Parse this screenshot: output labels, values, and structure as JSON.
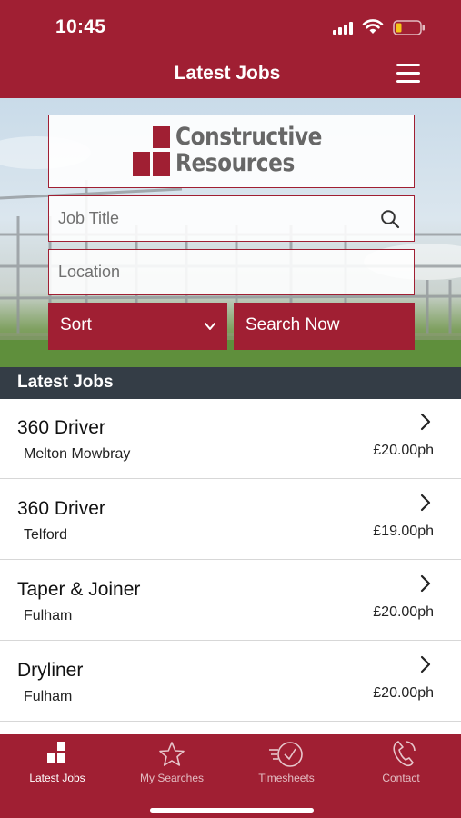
{
  "status_bar": {
    "time": "10:45"
  },
  "header": {
    "title": "Latest Jobs",
    "menu_icon": "hamburger-menu-icon"
  },
  "brand": {
    "line1": "Constructive",
    "line2": "Resources",
    "color": "#a01f33"
  },
  "search": {
    "job_title_placeholder": "Job Title",
    "location_placeholder": "Location",
    "sort_label": "Sort",
    "search_button": "Search Now"
  },
  "list": {
    "header": "Latest Jobs",
    "jobs": [
      {
        "title": "360 Driver",
        "location": "Melton Mowbray",
        "rate": "£20.00ph"
      },
      {
        "title": "360 Driver",
        "location": "Telford",
        "rate": "£19.00ph"
      },
      {
        "title": "Taper & Joiner",
        "location": "Fulham",
        "rate": "£20.00ph"
      },
      {
        "title": "Dryliner",
        "location": "Fulham",
        "rate": "£20.00ph"
      }
    ]
  },
  "tabs": [
    {
      "label": "Latest Jobs",
      "icon": "latest-jobs-icon",
      "active": true
    },
    {
      "label": "My Searches",
      "icon": "star-icon",
      "active": false
    },
    {
      "label": "Timesheets",
      "icon": "timesheet-clock-icon",
      "active": false
    },
    {
      "label": "Contact",
      "icon": "phone-icon",
      "active": false
    }
  ],
  "colors": {
    "primary": "#a01f33",
    "section_header": "#343d46"
  }
}
